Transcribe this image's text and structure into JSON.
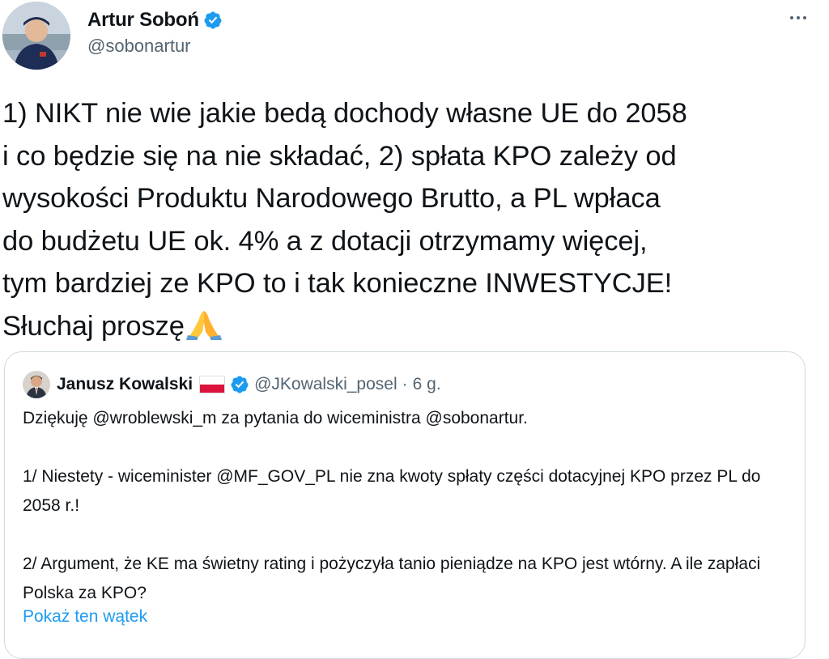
{
  "author": {
    "name": "Artur Soboń",
    "handle": "@sobonartur",
    "verified": true,
    "avatar_icon": "avatar-photo"
  },
  "menu": {
    "icon": "more-options-icon"
  },
  "tweet": {
    "text": "1) NIKT nie wie jakie bedą dochody własne UE do 2058\ni co będzie się na nie składać, 2) spłata KPO zależy od\nwysokości Produktu Narodowego Brutto, a PL wpłaca\ndo budżetu UE ok. 4% a z dotacji otrzymamy więcej,\ntym bardziej ze KPO to i tak konieczne INWESTYCJE!\nSłuchaj proszę",
    "emoji": "folded-hands-icon"
  },
  "quote": {
    "name": "Janusz Kowalski",
    "flag": "poland-flag-icon",
    "verified": true,
    "handle": "@JKowalski_posel",
    "separator": "·",
    "time": "6 g.",
    "paragraphs": [
      "Dziękuję @wroblewski_m za pytania do wiceministra @sobonartur.",
      "1/ Niestety - wiceminister @MF_GOV_PL nie zna kwoty spłaty części dotacyjnej KPO przez PL do 2058 r.!",
      "2/ Argument, że KE ma świetny rating i pożyczyła tanio pieniądze na KPO jest wtórny. A ile zapłaci Polska za KPO?"
    ],
    "show_thread": "Pokaż ten wątek"
  },
  "colors": {
    "text": "#0f1419",
    "secondary": "#536471",
    "accent": "#1d9bf0",
    "border": "#cfd9de",
    "flag_red": "#dc143c"
  }
}
